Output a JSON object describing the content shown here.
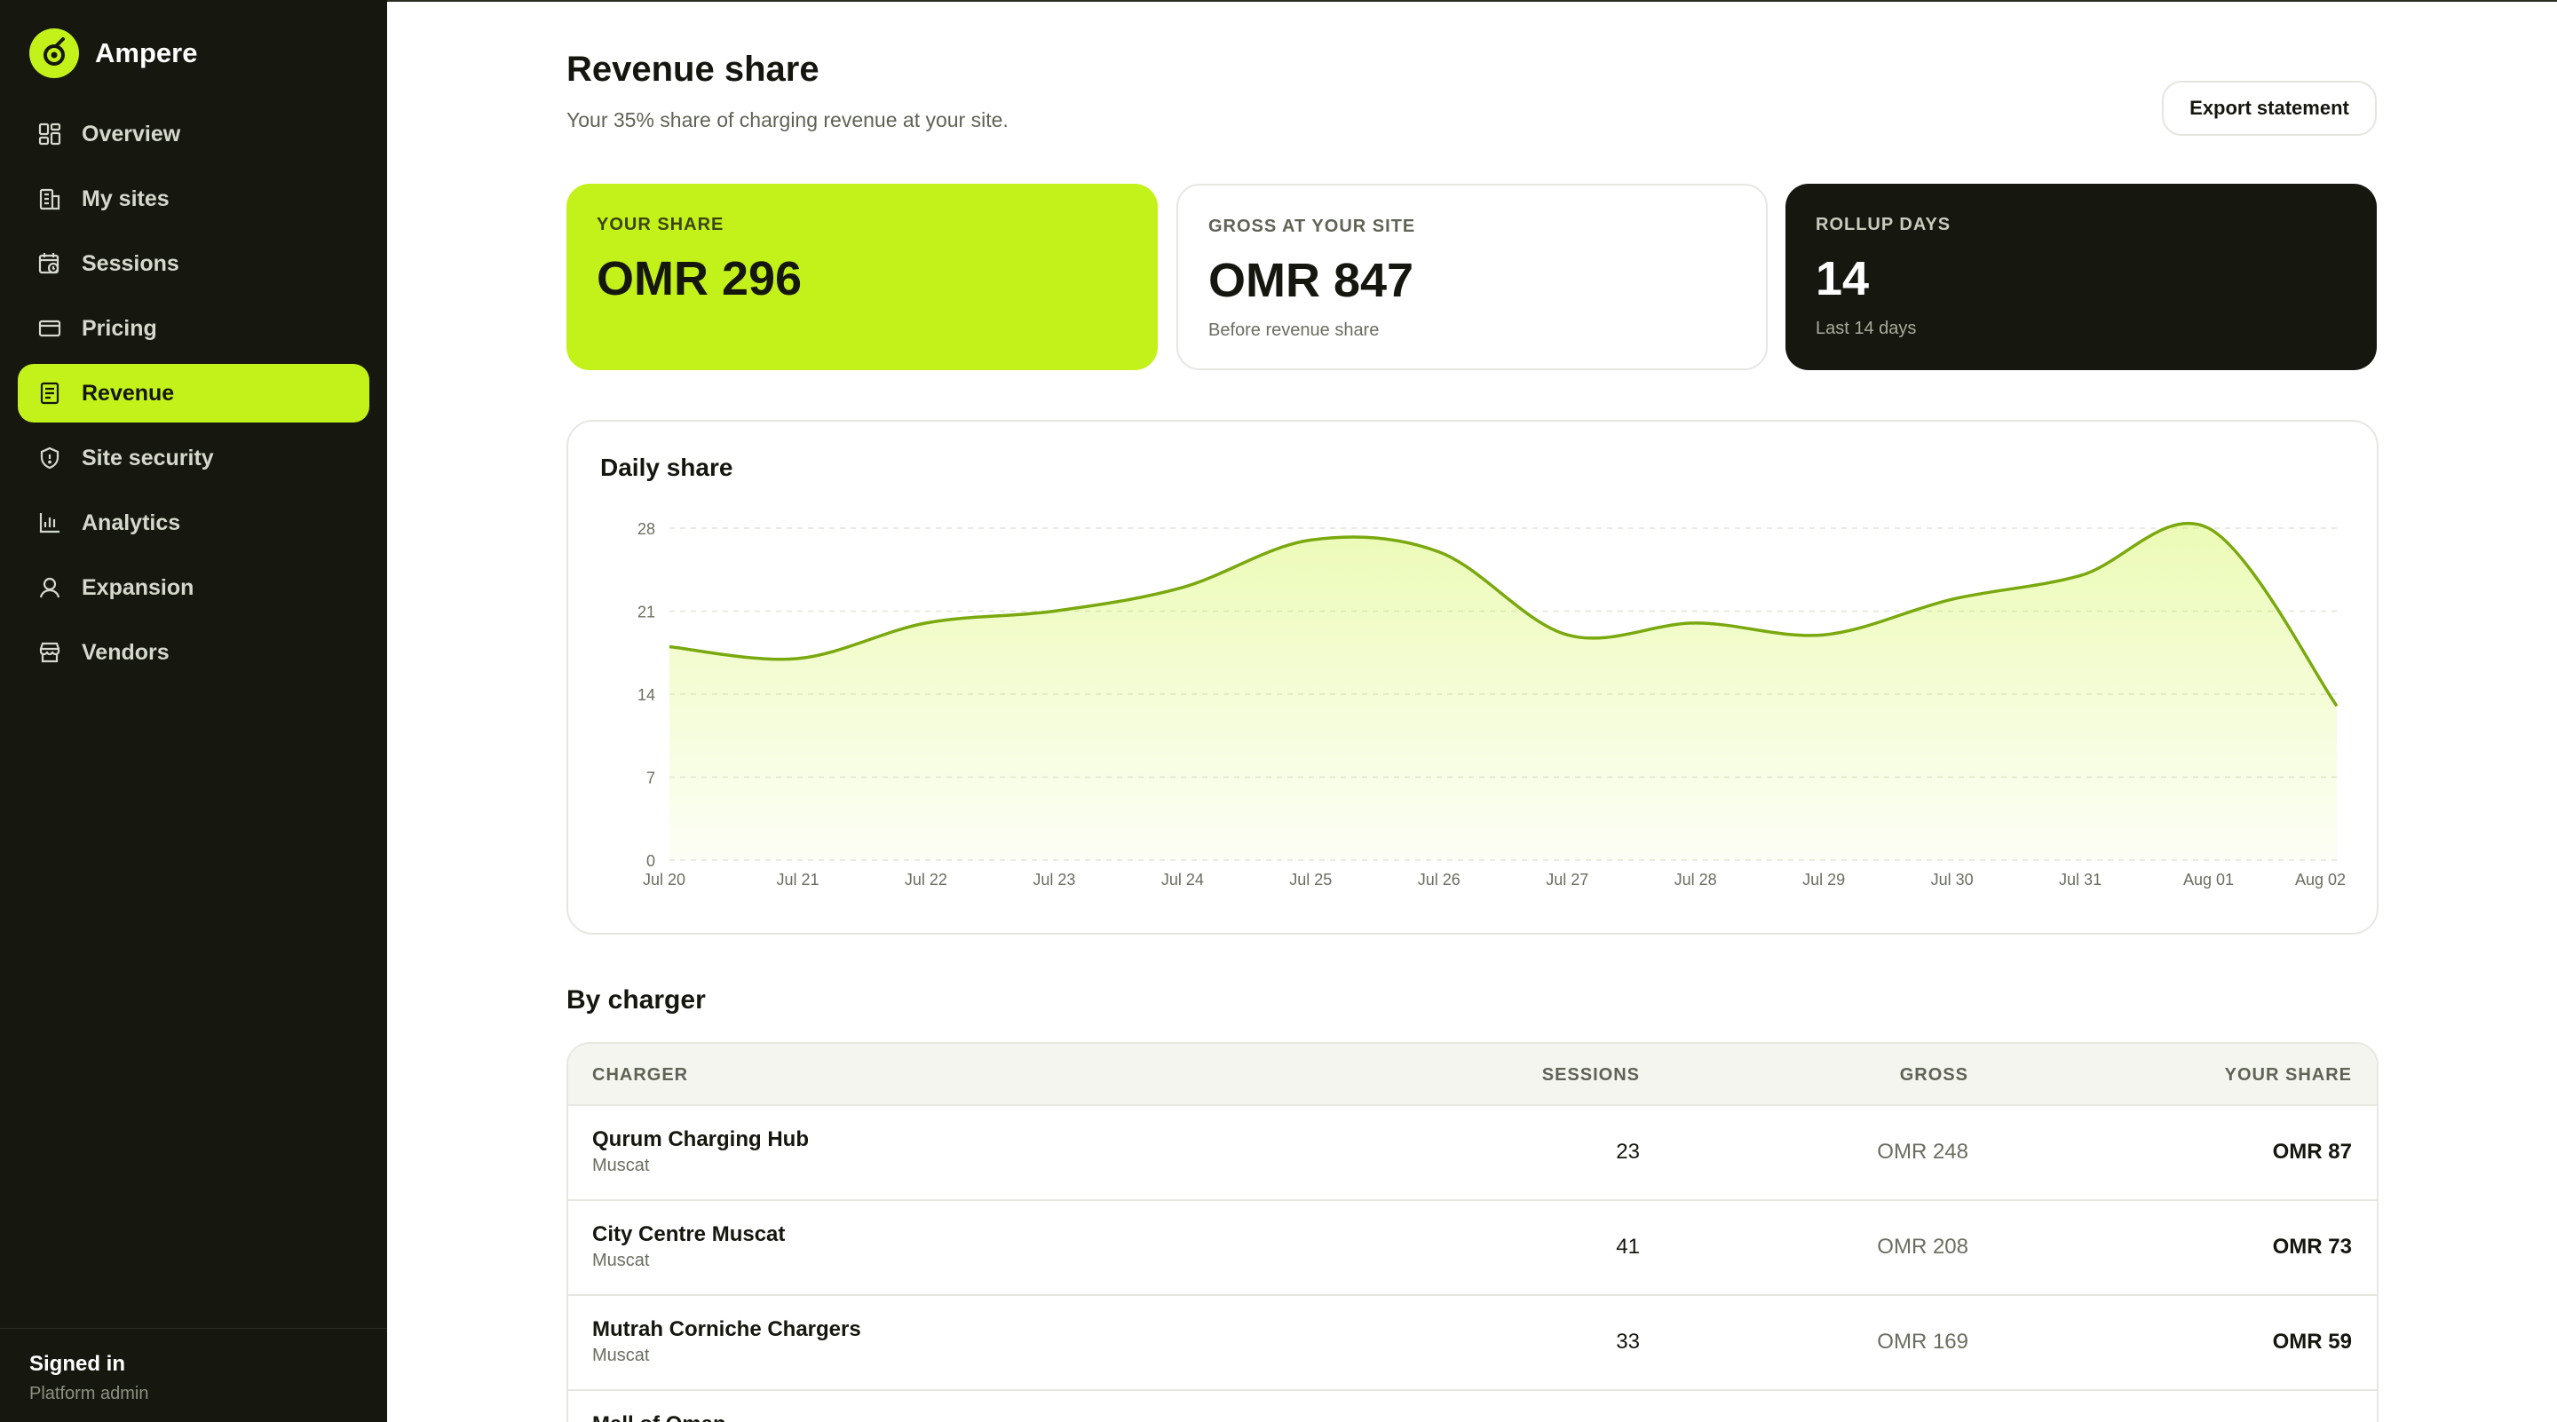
{
  "app": {
    "name": "Ampere"
  },
  "sidebar": {
    "items": [
      {
        "label": "Overview",
        "icon": "grid-icon",
        "active": false
      },
      {
        "label": "My sites",
        "icon": "building-icon",
        "active": false
      },
      {
        "label": "Sessions",
        "icon": "calendar-clock-icon",
        "active": false
      },
      {
        "label": "Pricing",
        "icon": "card-icon",
        "active": false
      },
      {
        "label": "Revenue",
        "icon": "receipt-icon",
        "active": true
      },
      {
        "label": "Site security",
        "icon": "shield-icon",
        "active": false
      },
      {
        "label": "Analytics",
        "icon": "bar-chart-icon",
        "active": false
      },
      {
        "label": "Expansion",
        "icon": "map-pin-icon",
        "active": false
      },
      {
        "label": "Vendors",
        "icon": "store-icon",
        "active": false
      }
    ],
    "footer": {
      "title": "Signed in",
      "subtitle": "Platform admin"
    }
  },
  "header": {
    "title": "Revenue share",
    "subtitle": "Your 35% share of charging revenue at your site.",
    "export_label": "Export statement"
  },
  "stats": [
    {
      "label": "YOUR SHARE",
      "value": "OMR 296",
      "sub": ""
    },
    {
      "label": "GROSS AT YOUR SITE",
      "value": "OMR 847",
      "sub": "Before revenue share"
    },
    {
      "label": "ROLLUP DAYS",
      "value": "14",
      "sub": "Last 14 days"
    }
  ],
  "chart": {
    "title": "Daily share",
    "accent": "#7aa90f",
    "fill": "#c3f21b"
  },
  "chart_data": {
    "type": "area",
    "title": "Daily share",
    "xlabel": "",
    "ylabel": "",
    "x": [
      "Jul 20",
      "Jul 21",
      "Jul 22",
      "Jul 23",
      "Jul 24",
      "Jul 25",
      "Jul 26",
      "Jul 27",
      "Jul 28",
      "Jul 29",
      "Jul 30",
      "Jul 31",
      "Aug 01",
      "Aug 02"
    ],
    "series": [
      {
        "values": [
          18,
          17,
          20,
          21,
          23,
          27,
          26,
          19,
          20,
          19,
          22,
          24,
          28,
          13
        ]
      }
    ],
    "ylim": [
      0,
      28
    ],
    "yticks": [
      0,
      7,
      14,
      21,
      28
    ],
    "grid": true
  },
  "table": {
    "title": "By charger",
    "columns": [
      "CHARGER",
      "SESSIONS",
      "GROSS",
      "YOUR SHARE"
    ],
    "rows": [
      {
        "name": "Qurum Charging Hub",
        "city": "Muscat",
        "sessions": "23",
        "gross": "OMR 248",
        "share": "OMR 87"
      },
      {
        "name": "City Centre Muscat",
        "city": "Muscat",
        "sessions": "41",
        "gross": "OMR 208",
        "share": "OMR 73"
      },
      {
        "name": "Mutrah Corniche Chargers",
        "city": "Muscat",
        "sessions": "33",
        "gross": "OMR 169",
        "share": "OMR 59"
      },
      {
        "name": "Mall of Oman",
        "city": "",
        "sessions": "",
        "gross": "",
        "share": ""
      }
    ]
  },
  "colors": {
    "sidebar_bg": "#161810",
    "accent": "#c3f21b",
    "text": "#15170f",
    "muted": "#5f6355"
  }
}
